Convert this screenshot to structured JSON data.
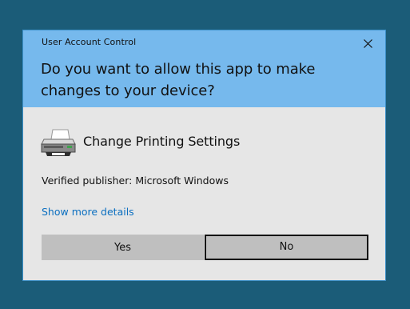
{
  "dialog": {
    "caption": "User Account Control",
    "question": "Do you want to allow this app to make changes to your device?",
    "app_name": "Change Printing Settings",
    "publisher": "Verified publisher: Microsoft Windows",
    "details_link": "Show more details",
    "buttons": {
      "yes": "Yes",
      "no": "No"
    },
    "icons": {
      "close": "close-icon",
      "app": "printer-icon"
    }
  },
  "colors": {
    "desktop": "#1b5c78",
    "header": "#76b9ed",
    "body": "#e6e6e6",
    "button": "#bfbfbf",
    "link": "#0b6fc0"
  }
}
